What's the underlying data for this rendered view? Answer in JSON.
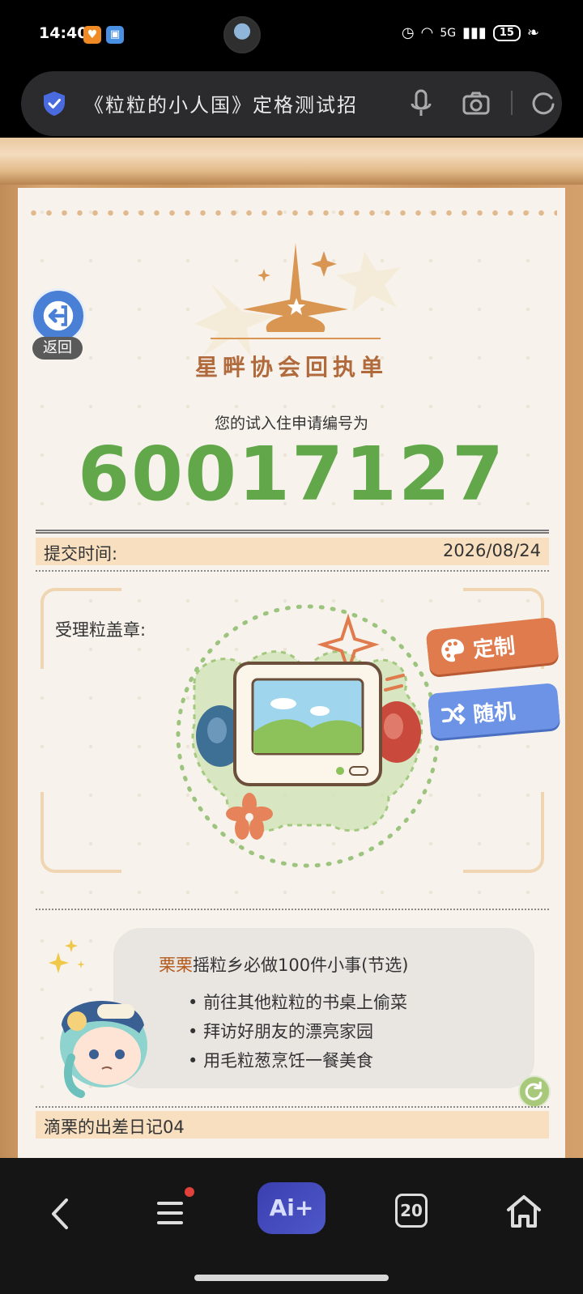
{
  "status_bar": {
    "time": "14:40",
    "network": "5G",
    "battery": "15"
  },
  "search_bar": {
    "query": "《粒粒的小人国》定格测试招"
  },
  "page": {
    "back_label": "返回",
    "logo_title": "星畔协会回执单",
    "apply_label": "您的试入住申请编号为",
    "apply_number": "60017127",
    "submit_label": "提交时间:",
    "submit_date": "2026/08/24",
    "stamp_label": "受理粒盖章:",
    "custom_button": "定制",
    "random_button": "随机",
    "todo": {
      "name": "栗栗",
      "title_rest": "摇粒乡必做100件小事(节选)",
      "items": [
        "前往其他粒粒的书桌上偷菜",
        "拜访好朋友的漂亮家园",
        "用毛粒葱烹饪一餐美食"
      ]
    },
    "diary_label": "滴栗的出差日记04"
  },
  "bottom_nav": {
    "ai_label": "Ai+",
    "tab_count": "20"
  },
  "colors": {
    "number_green": "#62a84a",
    "title_brown": "#b06a3b",
    "custom_orange": "#e07b4e",
    "random_blue": "#6d93e6",
    "band_peach": "#f7dfc0"
  }
}
